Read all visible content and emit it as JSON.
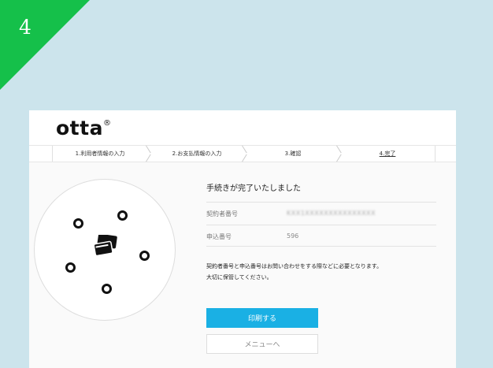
{
  "corner_badge": {
    "number": "4",
    "color": "#15c04a"
  },
  "header": {
    "logo": "otta",
    "logo_mark": "®"
  },
  "steps": [
    {
      "label": "1.利用者情報の入力"
    },
    {
      "label": "2.お支払情報の入力"
    },
    {
      "label": "3.確認"
    },
    {
      "label": "4.完了",
      "active": true
    }
  ],
  "main": {
    "title": "手続きが完了いたしました",
    "fields": [
      {
        "label": "契約者番号",
        "value": "KXX1XXXXXXXXXXXXXXX"
      },
      {
        "label": "申込番号",
        "value": "596"
      }
    ],
    "note_lines": [
      "契約者番号と申込番号はお問い合わせをする際などに必要となります。",
      "大切に保管してください。"
    ],
    "print_button": "印刷する",
    "menu_button": "メニューへ"
  },
  "colors": {
    "background": "#cce4ec",
    "accent": "#1ab0e4"
  },
  "icons": [
    "cards-icon",
    "dot-icon"
  ]
}
